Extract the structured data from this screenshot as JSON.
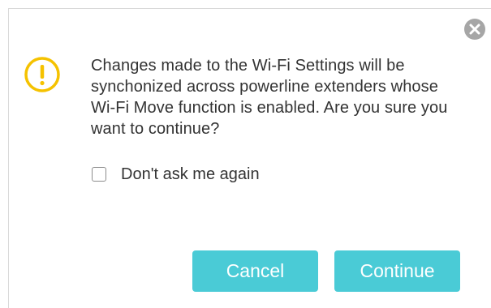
{
  "dialog": {
    "message": "Changes made to the Wi-Fi Settings will be synchonized across powerline extenders whose Wi-Fi Move function is enabled. Are you sure you want to continue?",
    "checkbox_label": "Don't ask me again",
    "checkbox_checked": false,
    "cancel_label": "Cancel",
    "continue_label": "Continue",
    "icons": {
      "close": "close-icon",
      "warning": "warning-icon",
      "checkbox": "checkbox-icon"
    }
  },
  "colors": {
    "accent": "#4acbd6",
    "warning": "#f5c200",
    "close_bg": "#a6a6a6",
    "text": "#333333"
  }
}
